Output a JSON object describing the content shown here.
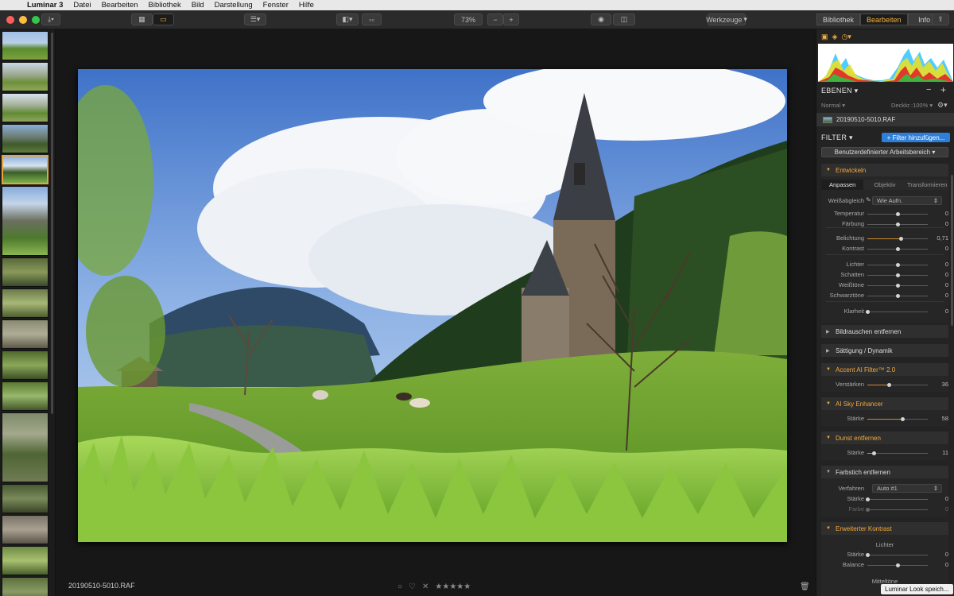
{
  "menubar": {
    "app": "Luminar 3",
    "items": [
      "Datei",
      "Bearbeiten",
      "Bibliothek",
      "Bild",
      "Darstellung",
      "Fenster",
      "Hilfe"
    ]
  },
  "toolbar": {
    "zoom": "73%",
    "tools_label": "Werkzeuge",
    "tabs": [
      "Bibliothek",
      "Bearbeiten",
      "Info"
    ],
    "active_tab": "Bearbeiten"
  },
  "canvas": {
    "filename": "20190510-5010.RAF",
    "stars": "★★★★★",
    "reject": "✕",
    "heart": "♡",
    "circle": "○"
  },
  "panel": {
    "layers_title": "EBENEN",
    "blend_mode": "Normal",
    "opacity": "Deckkr.:100%",
    "layer_name": "20190510-5010.RAF",
    "filter_title": "FILTER",
    "add_filter": "+ Filter hinzufügen...",
    "workspace": "Benutzerdefinierter Arbeitsbereich",
    "develop": {
      "title": "Entwickeln",
      "tabs": [
        "Anpassen",
        "Objektiv",
        "Transformieren"
      ],
      "whitebalance_label": "Weißabgleich",
      "whitebalance_value": "Wie Aufn.",
      "sliders": [
        {
          "label": "Temperatur",
          "value": "0",
          "pos": 0.5
        },
        {
          "label": "Färbung",
          "value": "0",
          "pos": 0.5
        },
        {
          "label": "Belichtung",
          "value": "0,71",
          "pos": 0.56
        },
        {
          "label": "Kontrast",
          "value": "0",
          "pos": 0.5
        },
        {
          "label": "Lichter",
          "value": "0",
          "pos": 0.5
        },
        {
          "label": "Schatten",
          "value": "0",
          "pos": 0.5
        },
        {
          "label": "Weißtöne",
          "value": "0",
          "pos": 0.5
        },
        {
          "label": "Schwarztöne",
          "value": "0",
          "pos": 0.5
        },
        {
          "label": "Klarheit",
          "value": "0",
          "pos": 0.0
        }
      ]
    },
    "filters": {
      "noise": "Bildrauschen entfernen",
      "saturation": "Sättigung / Dynamik",
      "accent_title": "Accent AI Filter™ 2.0",
      "accent_slider": {
        "label": "Verstärken",
        "value": "36",
        "pos": 0.36
      },
      "sky_title": "AI Sky Enhancer",
      "sky_slider": {
        "label": "Stärke",
        "value": "58",
        "pos": 0.58
      },
      "haze_title": "Dunst entfernen",
      "haze_slider": {
        "label": "Stärke",
        "value": "11",
        "pos": 0.11
      },
      "cast_title": "Farbstich entfernen",
      "cast_method_label": "Verfahren",
      "cast_method_value": "Auto #1",
      "cast_strength": {
        "label": "Stärke",
        "value": "0",
        "pos": 0.0
      },
      "cast_color": {
        "label": "Farbe",
        "value": "0",
        "pos": 0.0
      },
      "contrast_title": "Erweiterter Kontrast",
      "contrast_sub": "Lichter",
      "contrast_strength": {
        "label": "Stärke",
        "value": "0",
        "pos": 0.0
      },
      "contrast_balance": {
        "label": "Balance",
        "value": "0",
        "pos": 0.5
      },
      "contrast_sub2": "Mitteltöne"
    }
  },
  "status_toast": "Luminar Look speich...",
  "colors": {
    "accent_orange": "#f4a93a",
    "blue_button": "#2e7fd9",
    "traffic_red": "#fc605b",
    "traffic_yellow": "#fdbc40",
    "traffic_green": "#34c84a"
  }
}
